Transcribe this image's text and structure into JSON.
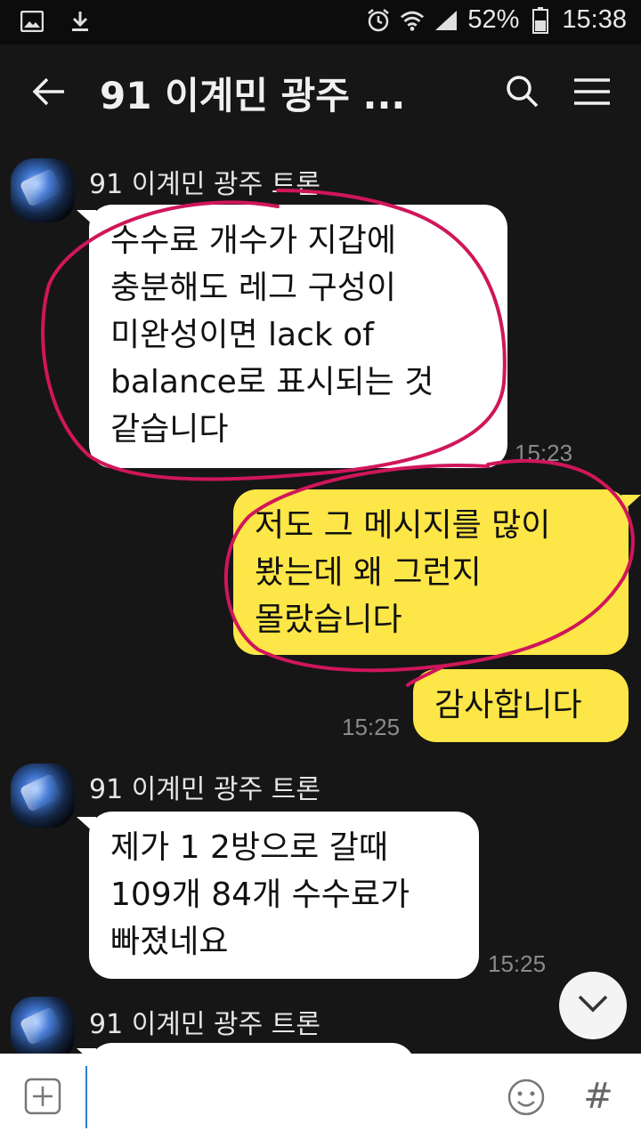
{
  "status_bar": {
    "battery": "52%",
    "time": "15:38",
    "icons": [
      "gallery-icon",
      "download-icon",
      "alarm-icon",
      "wifi-icon",
      "signal-icon",
      "battery-icon"
    ]
  },
  "header": {
    "title": "91 이계민 광주 ...",
    "icons": [
      "back-arrow-icon",
      "search-icon",
      "menu-icon"
    ]
  },
  "messages": [
    {
      "side": "left",
      "sender": "91 이계민 광주 트론",
      "text": "수수료 개수가 지갑에\n충분해도  레그 구성이\n미완성이면 lack of\nbalance로 표시되는 것\n같습니다",
      "time": "15:23"
    },
    {
      "side": "right",
      "text": "저도 그 메시지를 많이\n봤는데 왜 그런지\n몰랐습니다"
    },
    {
      "side": "right",
      "text": "감사합니다",
      "time": "15:25"
    },
    {
      "side": "left",
      "sender": "91 이계민 광주 트론",
      "text": "제가 1  2방으로  갈때\n109개 84개 수수료가\n빠졌네요",
      "time": "15:25"
    },
    {
      "side": "left",
      "sender": "91 이계민 광주 트론",
      "text": ""
    }
  ],
  "input_bar": {
    "placeholder": "",
    "icons": [
      "add-icon",
      "emoji-icon",
      "hashtag-icon"
    ],
    "hash_label": "#"
  },
  "colors": {
    "background": "#161616",
    "bubble_other": "#ffffff",
    "bubble_mine": "#fde647",
    "annotation": "#d0165a"
  }
}
